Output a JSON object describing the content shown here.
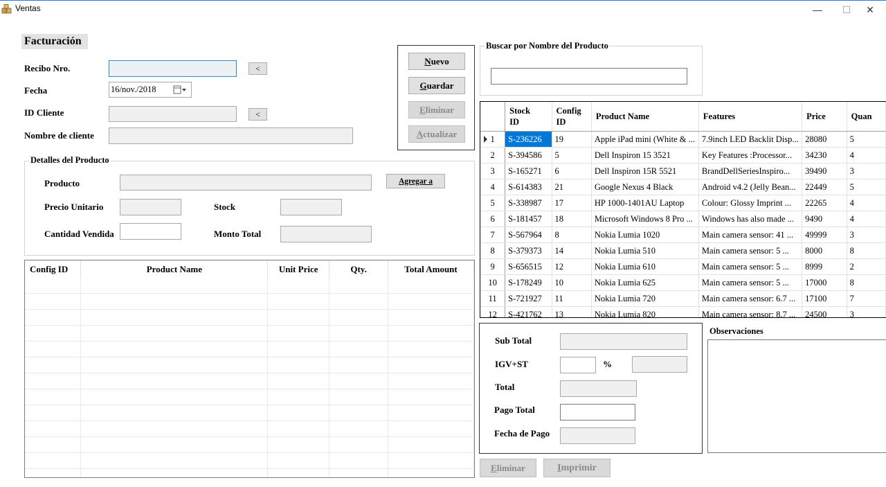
{
  "window": {
    "title": "Ventas",
    "minimize": "—",
    "maximize": "☐",
    "close": "✕"
  },
  "header": {
    "section_title": "Facturación"
  },
  "form": {
    "recibo_label": "Recibo Nro.",
    "recibo_value": "",
    "fecha_label": "Fecha",
    "fecha_value": "16/nov./2018",
    "id_cliente_label": "ID Cliente",
    "id_cliente_value": "",
    "nombre_cliente_label": "Nombre de cliente",
    "nombre_cliente_value": "",
    "lookup_button": "<"
  },
  "actions": {
    "nuevo": "Nuevo",
    "guardar": "Guardar",
    "eliminar": "Eliminar",
    "actualizar": "Actualizar"
  },
  "detalles": {
    "group_title": "Detalles del Producto",
    "producto_label": "Producto",
    "agregar_button": "Agregar a",
    "precio_label": "Precio Unitario",
    "stock_label": "Stock",
    "cantidad_label": "Cantidad Vendida",
    "monto_label": "Monto Total"
  },
  "detail_grid": {
    "columns": [
      "Config ID",
      "Product Name",
      "Unit Price",
      "Qty.",
      "Total Amount"
    ]
  },
  "search": {
    "group_title": "Buscar por Nombre del Producto",
    "value": ""
  },
  "product_grid": {
    "columns": [
      "",
      "Stock\nID",
      "Config\nID",
      "Product Name",
      "Features",
      "Price",
      "Quan"
    ],
    "rows": [
      [
        "1",
        "S-236226",
        "19",
        "Apple iPad mini (White & ...",
        "7.9inch LED Backlit Disp...",
        "28080",
        "5"
      ],
      [
        "2",
        "S-394586",
        "5",
        "Dell Inspiron 15 3521",
        "Key Features :Processor...",
        "34230",
        "4"
      ],
      [
        "3",
        "S-165271",
        "6",
        "Dell Inspiron 15R 5521",
        "BrandDellSeriesInspiro...",
        "39490",
        "3"
      ],
      [
        "4",
        "S-614383",
        "21",
        "Google Nexus 4 Black",
        "Android v4.2 (Jelly Bean...",
        "22449",
        "5"
      ],
      [
        "5",
        "S-338987",
        "17",
        "HP 1000-1401AU Laptop",
        "Colour: Glossy Imprint ...",
        "22265",
        "4"
      ],
      [
        "6",
        "S-181457",
        "18",
        "Microsoft Windows 8 Pro ...",
        "Windows has also made ...",
        "9490",
        "4"
      ],
      [
        "7",
        "S-567964",
        "8",
        "Nokia Lumia 1020",
        "Main camera sensor: 41 ...",
        "49999",
        "3"
      ],
      [
        "8",
        "S-379373",
        "14",
        "Nokia Lumia 510",
        "Main camera sensor: 5 ...",
        "8000",
        "8"
      ],
      [
        "9",
        "S-656515",
        "12",
        "Nokia Lumia 610",
        "Main camera sensor: 5 ...",
        "8999",
        "2"
      ],
      [
        "10",
        "S-178249",
        "10",
        "Nokia Lumia 625",
        "Main camera sensor: 5 ...",
        "17000",
        "8"
      ],
      [
        "11",
        "S-721927",
        "11",
        "Nokia Lumia 720",
        "Main camera sensor: 6.7 ...",
        "17100",
        "7"
      ],
      [
        "12",
        "S-421762",
        "13",
        "Nokia Lumia 820",
        "Main camera sensor: 8.7 ...",
        "24500",
        "3"
      ]
    ]
  },
  "totals": {
    "subtotal_label": "Sub Total",
    "igv_label": "IGV+ST",
    "percent_sign": "%",
    "total_label": "Total",
    "pago_total_label": "Pago Total",
    "fecha_pago_label": "Fecha de Pago"
  },
  "observaciones": {
    "label": "Observaciones"
  },
  "bottom_actions": {
    "eliminar": "Eliminar",
    "imprimir": "Imprimir"
  }
}
